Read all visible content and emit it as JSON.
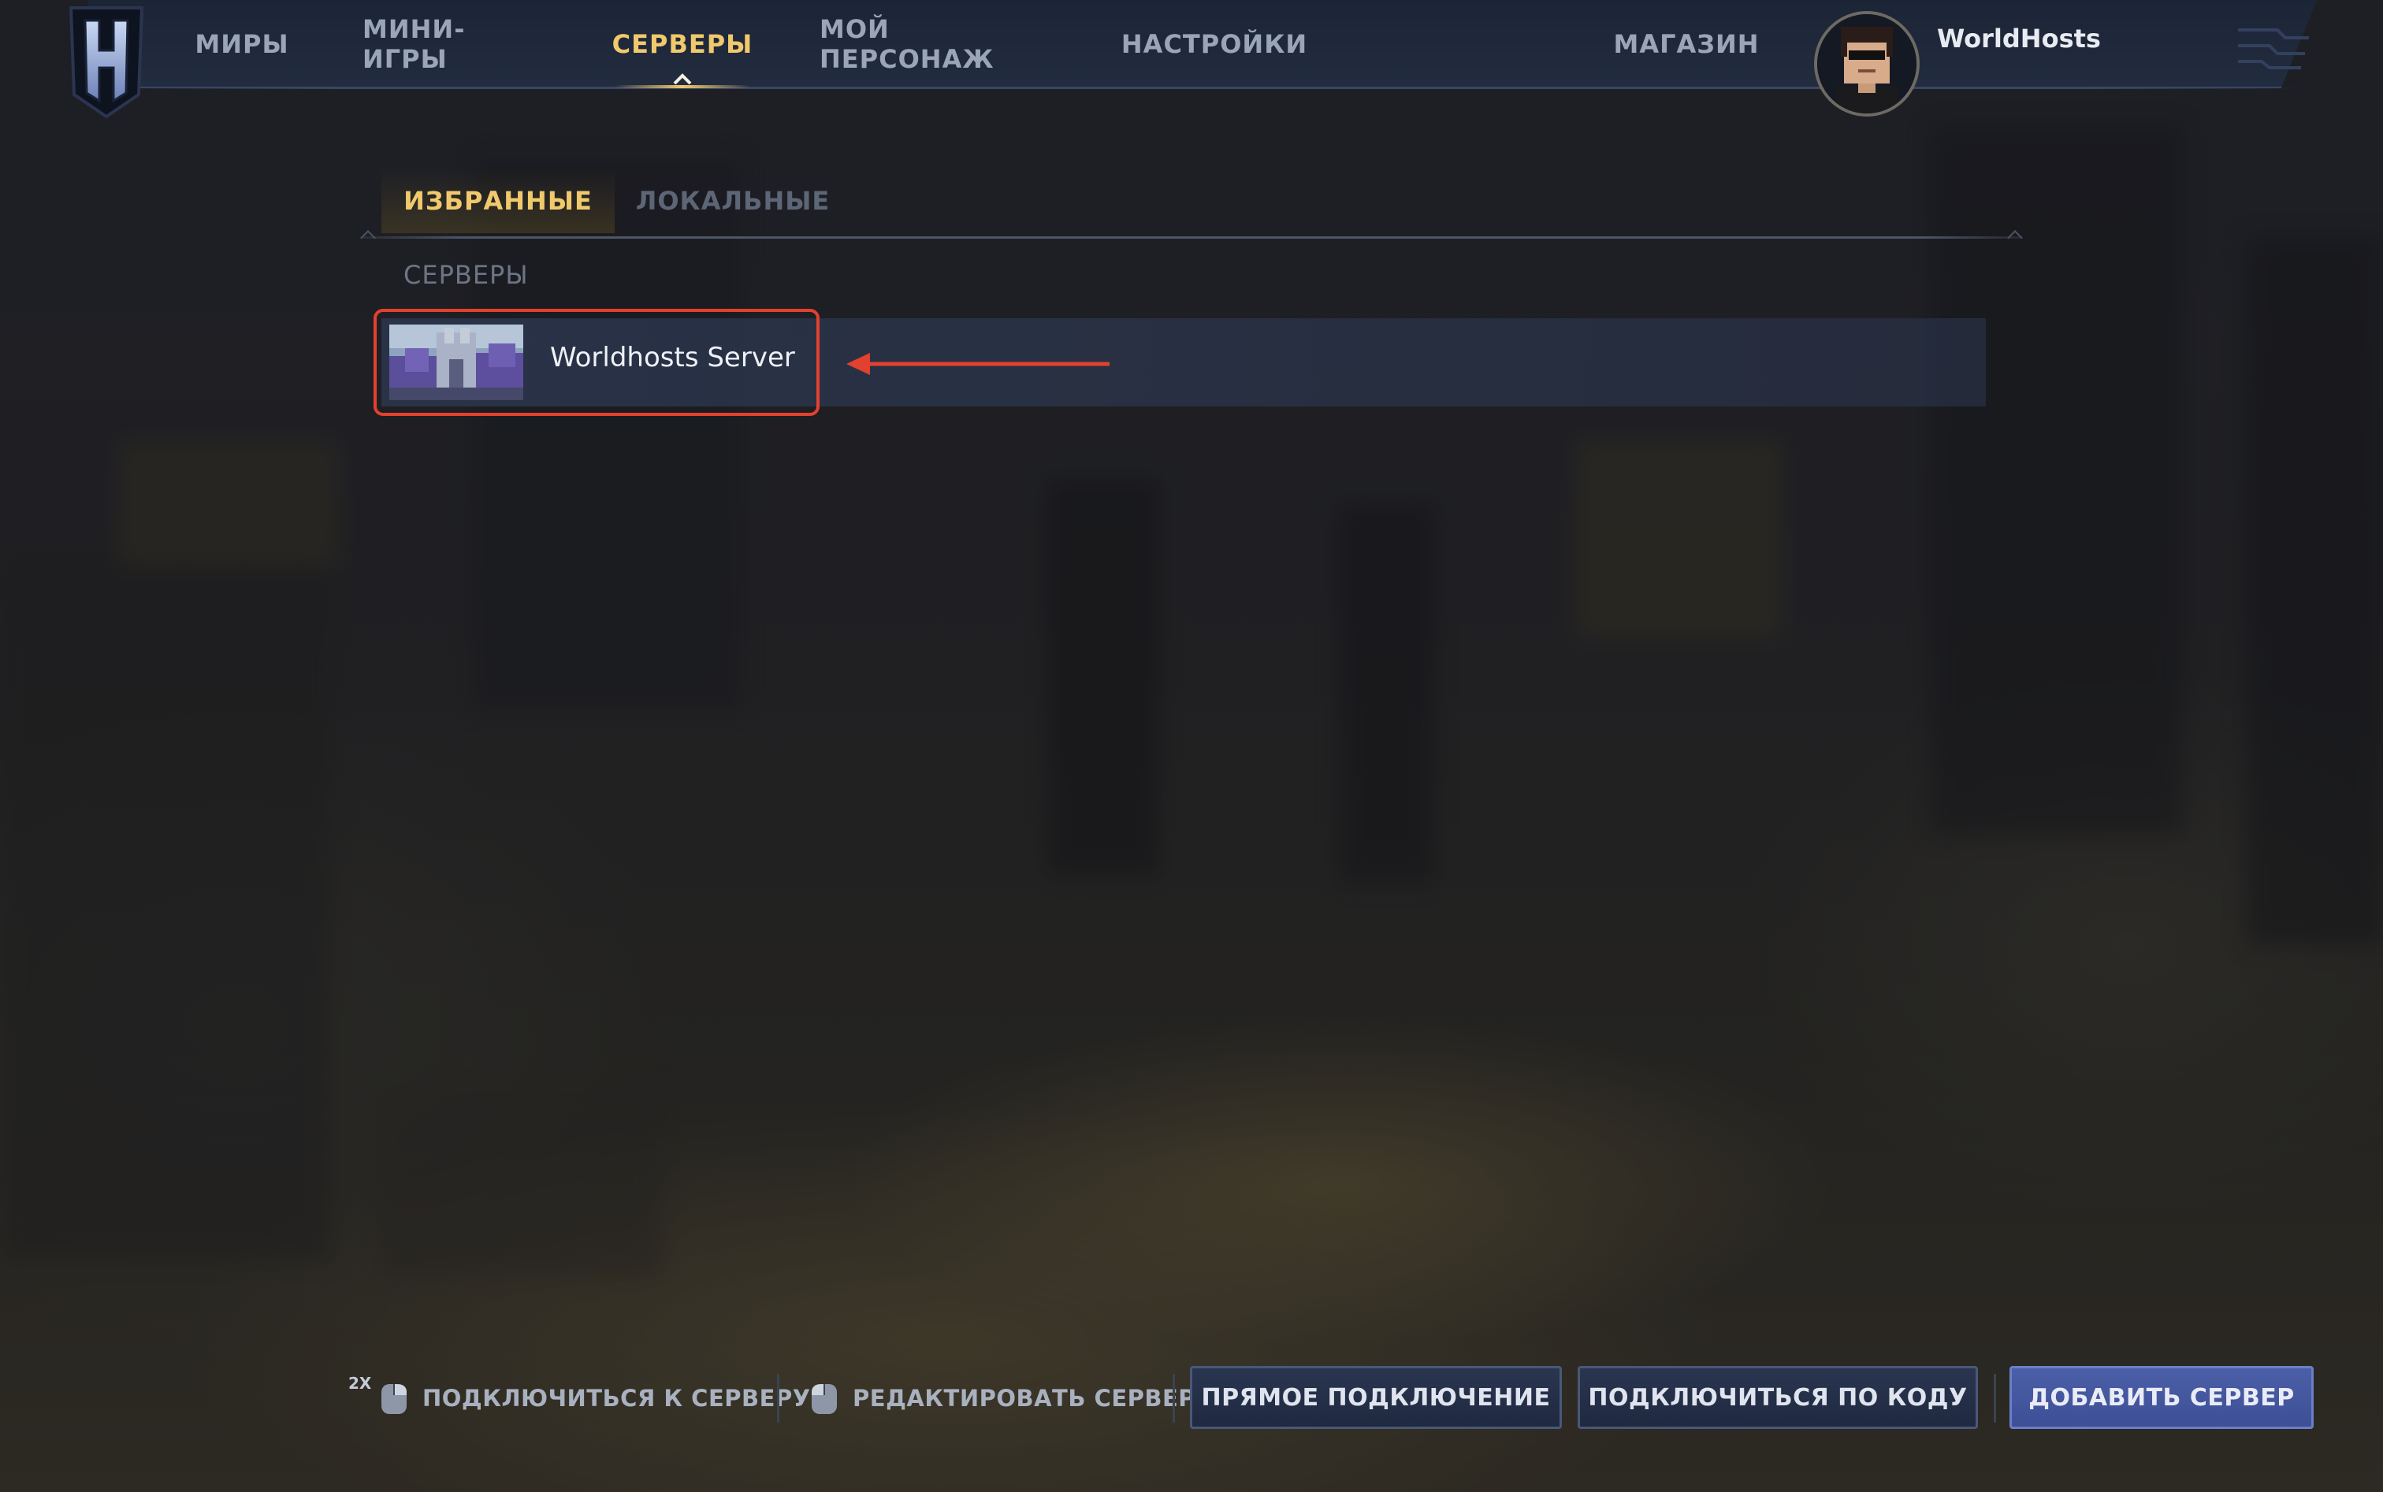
{
  "nav": {
    "items": [
      {
        "label": "МИРЫ",
        "active": false
      },
      {
        "label": "МИНИ-ИГРЫ",
        "active": false
      },
      {
        "label": "СЕРВЕРЫ",
        "active": true
      },
      {
        "label": "МОЙ ПЕРСОНАЖ",
        "active": false
      },
      {
        "label": "НАСТРОЙКИ",
        "active": false
      }
    ],
    "shop_label": "МАГАЗИН",
    "username": "WorldHosts"
  },
  "tabs": [
    {
      "label": "ИЗБРАННЫЕ",
      "active": true
    },
    {
      "label": "ЛОКАЛЬНЫЕ",
      "active": false
    }
  ],
  "section_heading": "СЕРВЕРЫ",
  "servers": [
    {
      "name": "Worldhosts Server"
    }
  ],
  "bottom_bar": {
    "double_click_badge": "2X",
    "connect_hint": "ПОДКЛЮЧИТЬСЯ К СЕРВЕРУ",
    "edit_hint": "РЕДАКТИРОВАТЬ СЕРВЕР",
    "direct_connect_label": "ПРЯМОЕ ПОДКЛЮЧЕНИЕ",
    "connect_by_code_label": "ПОДКЛЮЧИТЬСЯ ПО КОДУ",
    "add_server_label": "ДОБАВИТЬ СЕРВЕР"
  },
  "colors": {
    "accent_gold": "#f1c96d",
    "annotation_red": "#e2412f",
    "primary_button": "#4b5fa8"
  },
  "icons": {
    "logo": "hytale-h-logo-icon",
    "active_tab_caret": "chevron-up-icon",
    "mouse": "mouse-icon",
    "annotation_arrow": "arrow-left-icon"
  }
}
